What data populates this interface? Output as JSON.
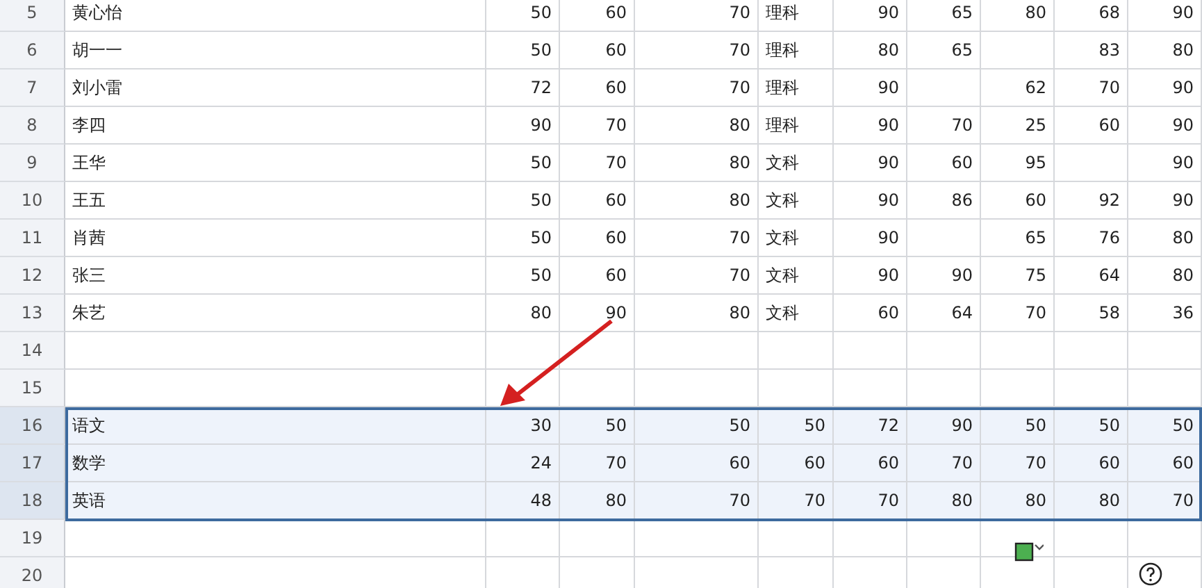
{
  "rows": [
    {
      "header": "5",
      "kind": "student",
      "selected": false,
      "cells": [
        "黄心怡",
        "50",
        "60",
        "70",
        "理科",
        "90",
        "65",
        "80",
        "68",
        "90"
      ]
    },
    {
      "header": "6",
      "kind": "student",
      "selected": false,
      "cells": [
        "胡一一",
        "50",
        "60",
        "70",
        "理科",
        "80",
        "65",
        null,
        "83",
        "80"
      ]
    },
    {
      "header": "7",
      "kind": "student",
      "selected": false,
      "cells": [
        "刘小雷",
        "72",
        "60",
        "70",
        "理科",
        "90",
        null,
        "62",
        "70",
        "90"
      ]
    },
    {
      "header": "8",
      "kind": "student",
      "selected": false,
      "cells": [
        "李四",
        "90",
        "70",
        "80",
        "理科",
        "90",
        "70",
        "25",
        "60",
        "90"
      ]
    },
    {
      "header": "9",
      "kind": "student",
      "selected": false,
      "cells": [
        "王华",
        "50",
        "70",
        "80",
        "文科",
        "90",
        "60",
        "95",
        null,
        "90"
      ]
    },
    {
      "header": "10",
      "kind": "student",
      "selected": false,
      "cells": [
        "王五",
        "50",
        "60",
        "80",
        "文科",
        "90",
        "86",
        "60",
        "92",
        "90"
      ]
    },
    {
      "header": "11",
      "kind": "student",
      "selected": false,
      "cells": [
        "肖茜",
        "50",
        "60",
        "70",
        "文科",
        "90",
        null,
        "65",
        "76",
        "80"
      ]
    },
    {
      "header": "12",
      "kind": "student",
      "selected": false,
      "cells": [
        "张三",
        "50",
        "60",
        "70",
        "文科",
        "90",
        "90",
        "75",
        "64",
        "80"
      ]
    },
    {
      "header": "13",
      "kind": "student",
      "selected": false,
      "cells": [
        "朱艺",
        "80",
        "90",
        "80",
        "文科",
        "60",
        "64",
        "70",
        "58",
        "36"
      ]
    },
    {
      "header": "14",
      "kind": "empty",
      "selected": false
    },
    {
      "header": "15",
      "kind": "empty",
      "selected": false
    },
    {
      "header": "16",
      "kind": "subject",
      "selected": true,
      "cells": [
        "语文",
        "30",
        "50",
        "50",
        "50",
        "72",
        "90",
        "50",
        "50",
        "50"
      ]
    },
    {
      "header": "17",
      "kind": "subject",
      "selected": true,
      "cells": [
        "数学",
        "24",
        "70",
        "60",
        "60",
        "60",
        "70",
        "70",
        "60",
        "60"
      ]
    },
    {
      "header": "18",
      "kind": "subject",
      "selected": true,
      "cells": [
        "英语",
        "48",
        "80",
        "70",
        "70",
        "70",
        "80",
        "80",
        "80",
        "70"
      ]
    },
    {
      "header": "19",
      "kind": "empty",
      "selected": false
    },
    {
      "header": "20",
      "kind": "empty",
      "selected": false
    }
  ]
}
